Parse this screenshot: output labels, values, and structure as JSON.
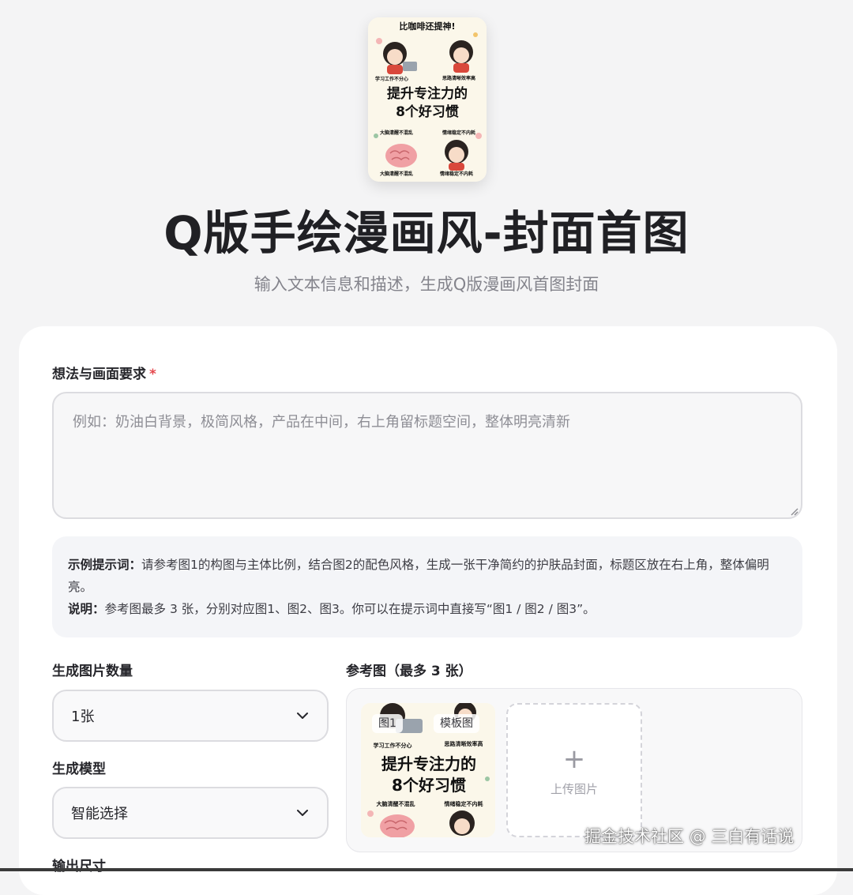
{
  "hero": {
    "title": "Q版手绘漫画风-封面首图",
    "subtitle": "输入文本信息和描述，生成Q版漫画风首图封面",
    "cover": {
      "top_banner": "比咖啡还提神!",
      "headline_1": "提升专注力的",
      "headline_2": "8个好习惯",
      "caption_tl": "学习工作不分心",
      "caption_tr": "思路清晰效率高",
      "caption_bl": "大脑清醒不混乱",
      "caption_br": "情绪稳定不内耗",
      "caption_bl2": "大脑清醒不混乱",
      "caption_br2": "情绪稳定不内耗"
    }
  },
  "form": {
    "idea_label": "想法与画面要求",
    "required_mark": "*",
    "idea_placeholder": "例如：奶油白背景，极简风格，产品在中间，右上角留标题空间，整体明亮清新",
    "hint": {
      "example_label": "示例提示词：",
      "example_text": "请参考图1的构图与主体比例，结合图2的配色风格，生成一张干净简约的护肤品封面，标题区放在右上角，整体偏明亮。",
      "note_label": "说明：",
      "note_text": "参考图最多 3 张，分别对应图1、图2、图3。你可以在提示词中直接写“图1 / 图2 / 图3”。"
    },
    "count_label": "生成图片数量",
    "count_value": "1张",
    "model_label": "生成模型",
    "model_value": "智能选择",
    "size_label": "输出尺寸",
    "ref_label": "参考图（最多 3 张）",
    "ref_images": [
      {
        "tag_index": "图1",
        "tag_type": "模板图"
      }
    ],
    "upload_label": "上传图片"
  },
  "watermark": "掘金技术社区 @ 三白有话说",
  "colors": {
    "background": "#f4f4f5",
    "card": "#ffffff",
    "required": "#e5484d",
    "cover_bg": "#fbf7ea"
  }
}
